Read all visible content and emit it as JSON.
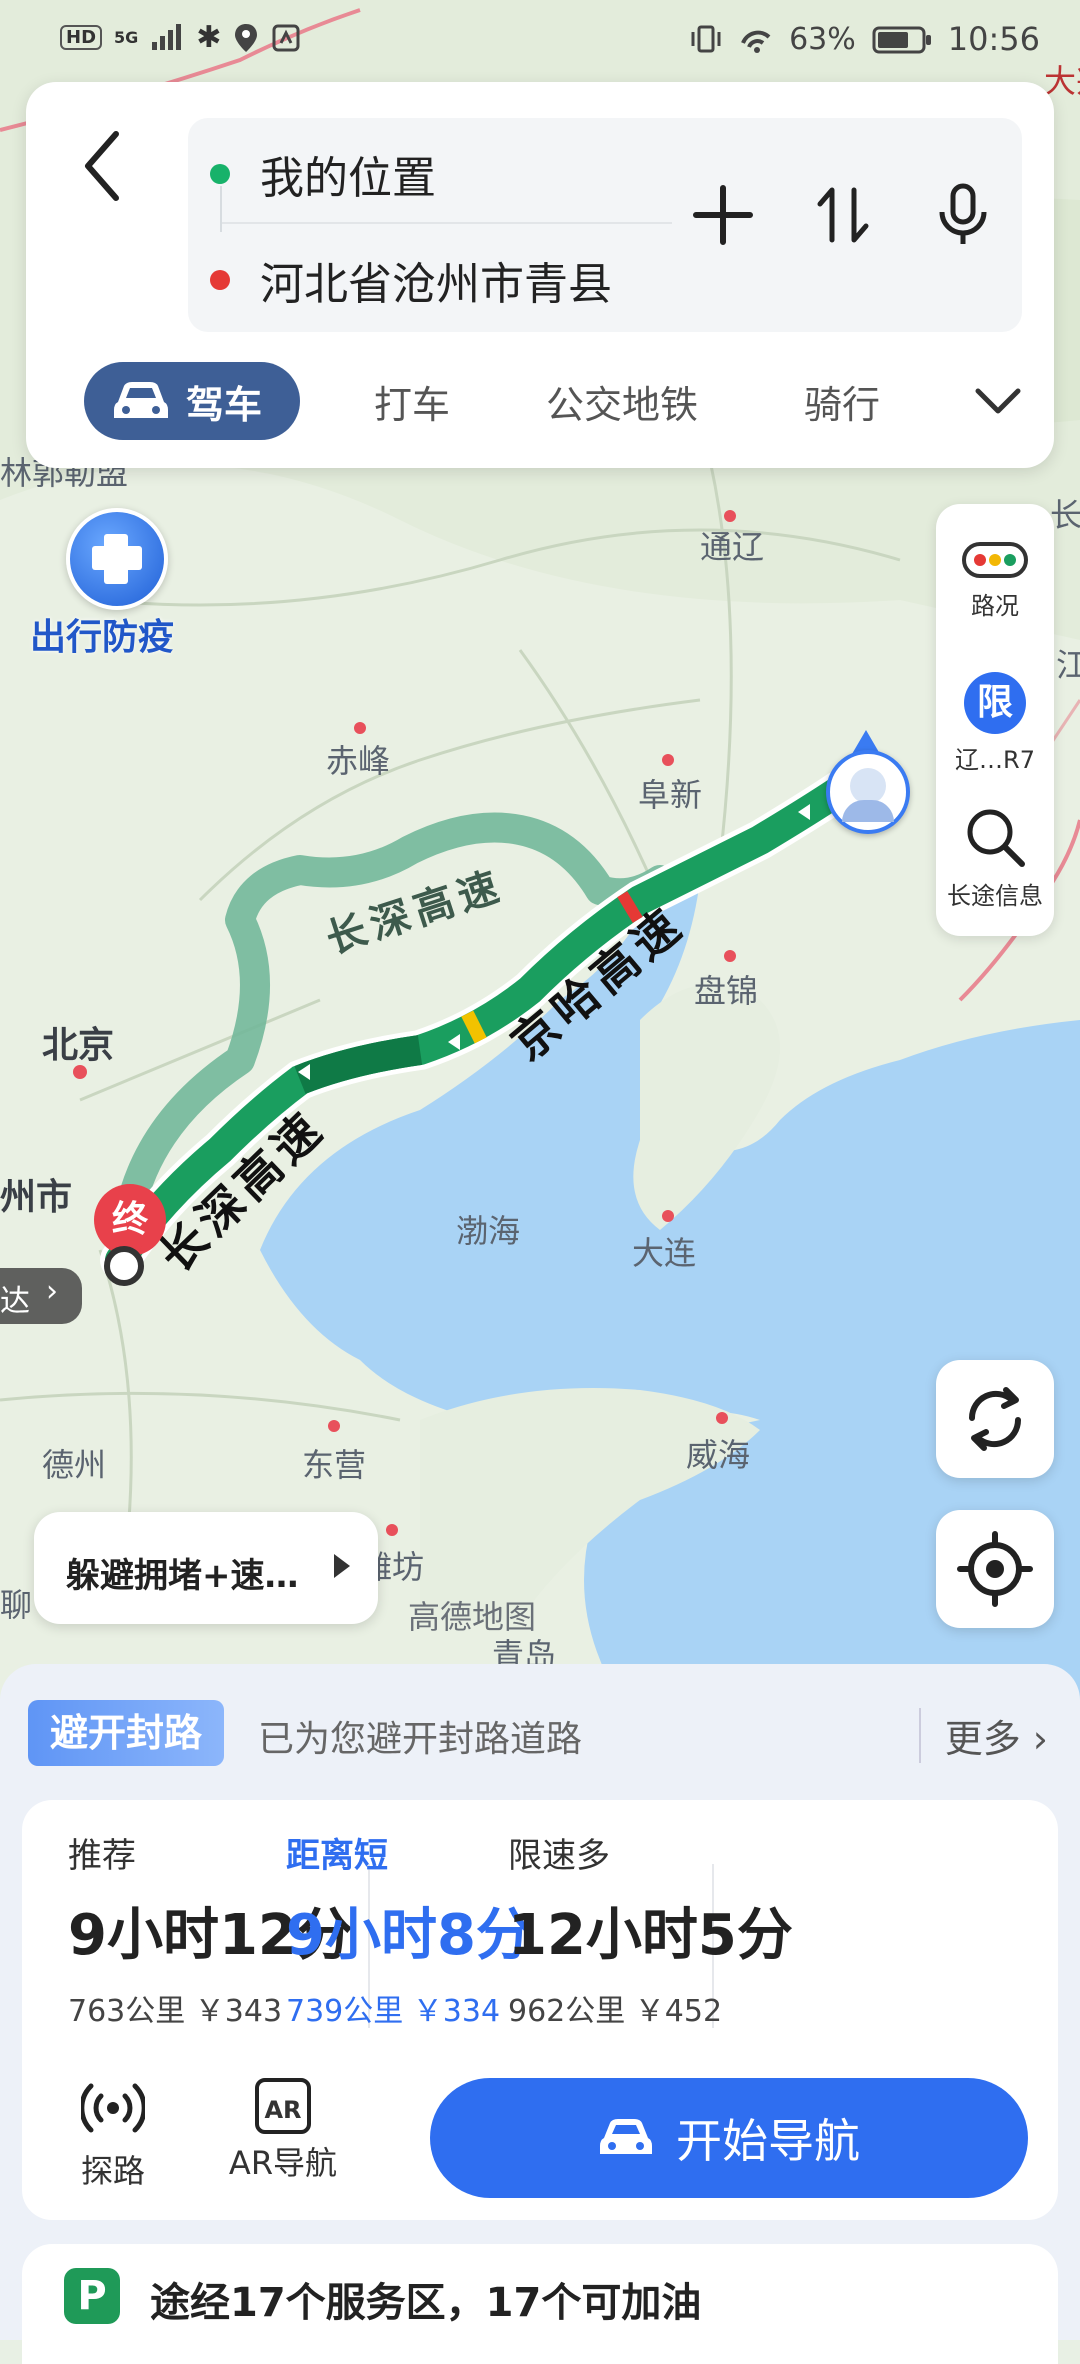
{
  "status_bar": {
    "hd": "HD",
    "signal": "5G",
    "battery_percent": "63%",
    "time": "10:56"
  },
  "route": {
    "origin": "我的位置",
    "destination": "河北省沧州市青县",
    "origin_color": "#17b26a",
    "destination_color": "#e53935"
  },
  "modes": [
    "驾车",
    "打车",
    "公交地铁",
    "骑行"
  ],
  "active_mode": "驾车",
  "map": {
    "badge": "出行防疫",
    "cities": {
      "tongliao": "通辽",
      "chifeng": "赤峰",
      "fuxin": "阜新",
      "panjin": "盘锦",
      "beijing": "北京",
      "dalian": "大连",
      "bohai": "渤海",
      "dezhou": "德州",
      "dongying": "东营",
      "weihai": "威海",
      "weifang": "潍坊",
      "qingdao": "青岛",
      "linguomeng": "林郭勒盟",
      "zhoushi": "州市",
      "liao": "聊",
      "chang": "长",
      "dabo": "大兴",
      "chang_edge": "长",
      "edge_j": "江"
    },
    "roads": {
      "changshen": "长深高速",
      "jingha": "京哈高速",
      "changshen_lower": "长深高速"
    },
    "end_marker": "终",
    "attribution": "高德地图",
    "arrive_chip": "达"
  },
  "side_tools": {
    "traffic": "路况",
    "restriction_badge": "限",
    "restriction": "辽…R7",
    "long_trip": "长途信息"
  },
  "avoid_chip": "躲避拥堵+速…",
  "notice": {
    "tag": "避开封路",
    "text": "已为您避开封路道路",
    "more": "更多"
  },
  "options": [
    {
      "tag": "推荐",
      "time": "9小时12分",
      "meta": "763公里 ￥343"
    },
    {
      "tag": "距离短",
      "time": "9小时8分",
      "meta": "739公里 ￥334"
    },
    {
      "tag": "限速多",
      "time": "12小时5分",
      "meta": "962公里 ￥452"
    }
  ],
  "actions": {
    "explore": "探路",
    "ar_icon": "AR",
    "ar_nav": "AR导航",
    "start": "开始导航"
  },
  "service": {
    "icon": "P",
    "text": "途经17个服务区，17个可加油"
  },
  "colors": {
    "accent": "#2f6ef0",
    "route_green": "#1a9e5f",
    "alt_route": "#73b89a",
    "sea": "#a9d3f5"
  }
}
